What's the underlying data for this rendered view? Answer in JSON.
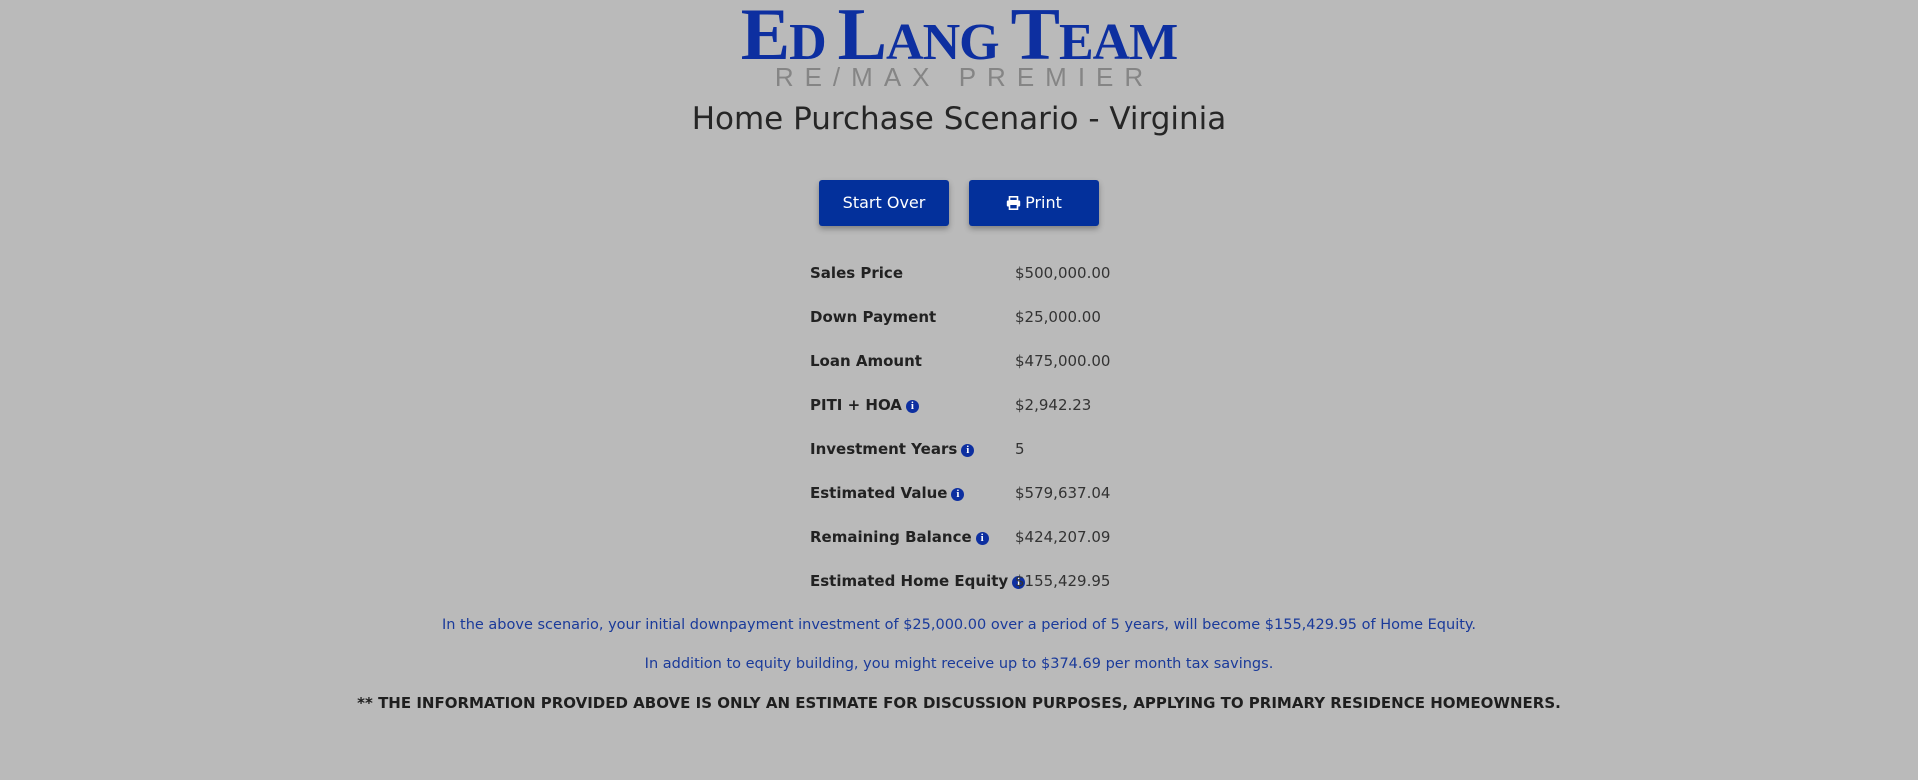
{
  "logo": {
    "name_part1_initial": "E",
    "name_part1_rest": "D ",
    "name_part2_initial": "L",
    "name_part2_rest": "ANG ",
    "name_part3_initial": "T",
    "name_part3_rest": "EAM",
    "brand_color": "#0d2fa0",
    "subtitle": "RE/MAX PREMIER"
  },
  "page_title": "Home Purchase Scenario - Virginia",
  "buttons": {
    "start_over": "Start Over",
    "print": "Print",
    "print_icon": "printer-icon",
    "color": "#03309b"
  },
  "summary": [
    {
      "label": "Sales Price",
      "value": "$500,000.00",
      "info": false
    },
    {
      "label": "Down Payment",
      "value": "$25,000.00",
      "info": false
    },
    {
      "label": "Loan Amount",
      "value": "$475,000.00",
      "info": false
    },
    {
      "label": "PITI + HOA",
      "value": "$2,942.23",
      "info": true
    },
    {
      "label": "Investment Years",
      "value": "5",
      "info": true
    },
    {
      "label": "Estimated Value",
      "value": "$579,637.04",
      "info": true
    },
    {
      "label": "Remaining Balance",
      "value": "$424,207.09",
      "info": true
    },
    {
      "label": "Estimated Home Equity",
      "value": "$155,429.95",
      "info": true
    }
  ],
  "info_icon_glyph": "i",
  "notes": {
    "equity_sentence": "In the above scenario, your initial downpayment investment of $25,000.00 over a period of 5 years, will become $155,429.95 of Home Equity.",
    "tax_sentence": "In addition to equity building, you might receive up to $374.69 per month tax savings.",
    "disclaimer": "** THE INFORMATION PROVIDED ABOVE IS ONLY AN ESTIMATE FOR DISCUSSION PURPOSES, APPLYING TO PRIMARY RESIDENCE HOMEOWNERS."
  }
}
